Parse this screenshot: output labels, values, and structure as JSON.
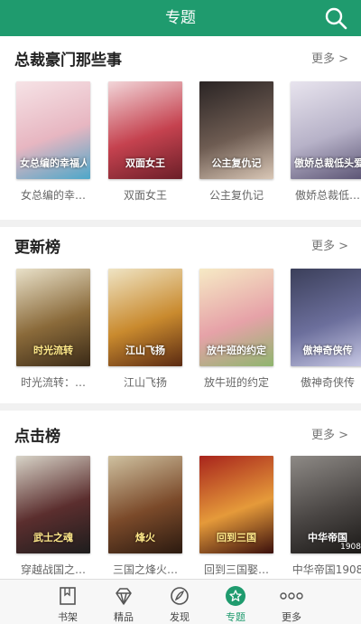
{
  "header": {
    "title": "专题"
  },
  "sections": [
    {
      "title": "总裁豪门那些事",
      "more": "更多",
      "books": [
        {
          "name": "女总编的幸…",
          "cover_text": "女总编的幸福人生",
          "colors": [
            "#f6e3e6",
            "#e7b6c1",
            "#4da7c9"
          ]
        },
        {
          "name": "双面女王",
          "cover_text": "双面女王",
          "colors": [
            "#f2d6d9",
            "#c5424f",
            "#6b1f28"
          ]
        },
        {
          "name": "公主复仇记",
          "cover_text": "公主复仇记",
          "colors": [
            "#2a2424",
            "#6e5c52",
            "#d9c7b6"
          ]
        },
        {
          "name": "傲娇总裁低…",
          "cover_text": "傲娇总裁低头爱",
          "colors": [
            "#e8e4ee",
            "#b7b2c8",
            "#5b5474"
          ]
        }
      ]
    },
    {
      "title": "更新榜",
      "more": "更多",
      "books": [
        {
          "name": "时光流转：…",
          "cover_text": "时光流转",
          "colors": [
            "#e9e1c9",
            "#8a6a3a",
            "#3a2a17"
          ]
        },
        {
          "name": "江山飞扬",
          "cover_text": "江山飞扬",
          "colors": [
            "#efe4c4",
            "#c98a2e",
            "#5a2a12"
          ]
        },
        {
          "name": "放牛班的约定",
          "cover_text": "放牛班的约定",
          "colors": [
            "#f6eac5",
            "#e6a2a8",
            "#8fb56e"
          ]
        },
        {
          "name": "傲神奇侠传",
          "cover_text": "傲神奇侠传",
          "colors": [
            "#3b3f5a",
            "#6c6f9c",
            "#c8c9e5"
          ]
        }
      ]
    },
    {
      "title": "点击榜",
      "more": "更多",
      "books": [
        {
          "name": "穿越战国之…",
          "cover_text": "武士之魂",
          "colors": [
            "#d8d4c8",
            "#5b2e2e",
            "#1d1d1d"
          ]
        },
        {
          "name": "三国之烽火…",
          "cover_text": "烽火",
          "colors": [
            "#cfc1a0",
            "#7b4a2a",
            "#2b1a10"
          ]
        },
        {
          "name": "回到三国娶…",
          "cover_text": "回到三国",
          "colors": [
            "#a8241c",
            "#e59a3a",
            "#3a0f0c"
          ]
        },
        {
          "name": "中华帝国1908",
          "cover_text": "中华帝国",
          "colors": [
            "#8e8a86",
            "#4a4644",
            "#1a1816"
          ]
        }
      ]
    }
  ],
  "cover_badge": "1908",
  "tabs": [
    {
      "label": "书架",
      "icon": "bookshelf-icon",
      "active": false
    },
    {
      "label": "精品",
      "icon": "diamond-icon",
      "active": false
    },
    {
      "label": "发现",
      "icon": "compass-icon",
      "active": false
    },
    {
      "label": "专题",
      "icon": "star-topic-icon",
      "active": true
    },
    {
      "label": "更多",
      "icon": "more-dots-icon",
      "active": false
    }
  ],
  "theme": {
    "accent": "#1f9b6e"
  }
}
